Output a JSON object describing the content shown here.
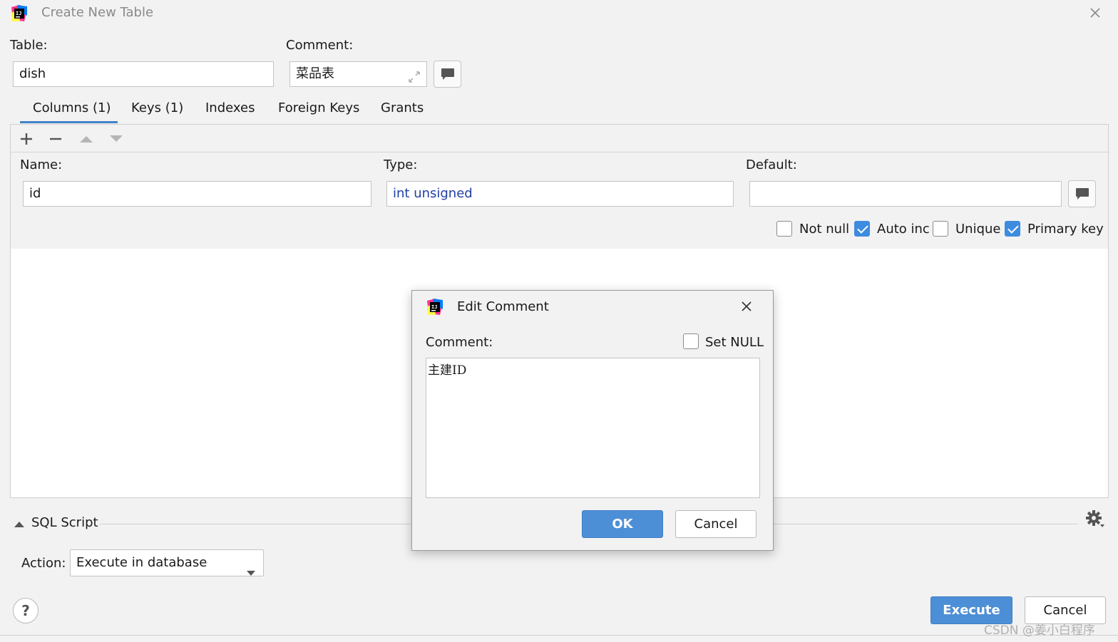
{
  "window": {
    "title": "Create New Table",
    "close_icon": "close-icon",
    "app_icon": "intellij-logo-icon"
  },
  "table": {
    "table_label": "Table:",
    "table_value": "dish",
    "comment_label": "Comment:",
    "comment_value": "菜品表"
  },
  "tabs": [
    {
      "label": "Columns (1)",
      "active": true
    },
    {
      "label": "Keys (1)",
      "active": false
    },
    {
      "label": "Indexes",
      "active": false
    },
    {
      "label": "Foreign Keys",
      "active": false
    },
    {
      "label": "Grants",
      "active": false
    }
  ],
  "column": {
    "name_label": "Name:",
    "name_value": "id",
    "type_label": "Type:",
    "type_value": "int unsigned",
    "default_label": "Default:",
    "default_value": ""
  },
  "checkboxes": {
    "not_null": {
      "label": "Not null",
      "checked": false
    },
    "auto_inc": {
      "label": "Auto inc",
      "checked": true
    },
    "unique": {
      "label": "Unique",
      "checked": false
    },
    "primary_key": {
      "label": "Primary key",
      "checked": true
    }
  },
  "sql": {
    "section_label": "SQL Script",
    "action_label": "Action:",
    "action_value": "Execute in database"
  },
  "footer": {
    "help_label": "?",
    "execute_label": "Execute",
    "cancel_label": "Cancel"
  },
  "dialog": {
    "title": "Edit Comment",
    "comment_label": "Comment:",
    "set_null_label": "Set NULL",
    "set_null_checked": false,
    "comment_text": "主建ID",
    "ok_label": "OK",
    "cancel_label": "Cancel"
  },
  "watermark": "CSDN @姜小白程序",
  "colors": {
    "accent": "#4d8fd6",
    "type_text": "#1f3fa3",
    "background": "#f2f2f2"
  }
}
